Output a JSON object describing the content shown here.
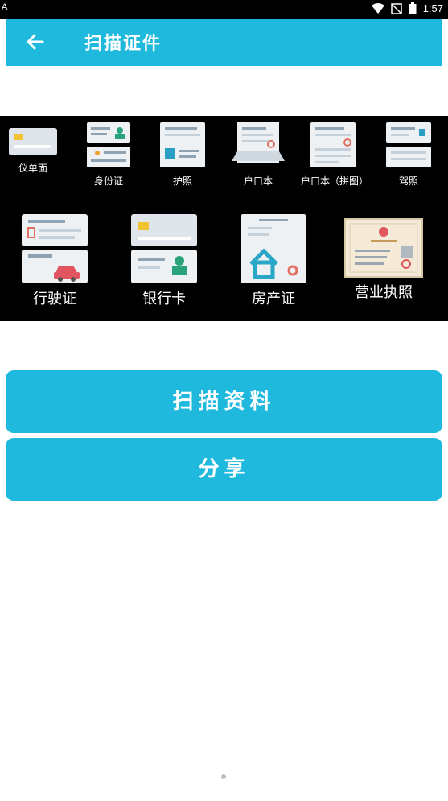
{
  "status_bar": {
    "left_label": "A",
    "time": "1:57"
  },
  "header": {
    "title": "扫描证件"
  },
  "documents": {
    "row1": [
      {
        "label": "仪单面",
        "icon": "card-icon"
      },
      {
        "label": "身份证",
        "icon": "id-card-icon"
      },
      {
        "label": "护照",
        "icon": "passport-icon"
      },
      {
        "label": "户口本",
        "icon": "household-book-icon"
      },
      {
        "label": "户口本（拼图）",
        "icon": "household-book-merge-icon"
      },
      {
        "label": "驾照",
        "icon": "driver-license-icon"
      }
    ],
    "row2": [
      {
        "label": "行驶证",
        "icon": "vehicle-license-icon"
      },
      {
        "label": "银行卡",
        "icon": "bank-card-icon"
      },
      {
        "label": "房产证",
        "icon": "property-cert-icon"
      },
      {
        "label": "营业执照",
        "icon": "business-license-icon"
      }
    ]
  },
  "buttons": {
    "scan_label": "扫描资料",
    "share_label": "分享"
  },
  "colors": {
    "accent": "#1eb9dd",
    "panel": "#000000"
  }
}
